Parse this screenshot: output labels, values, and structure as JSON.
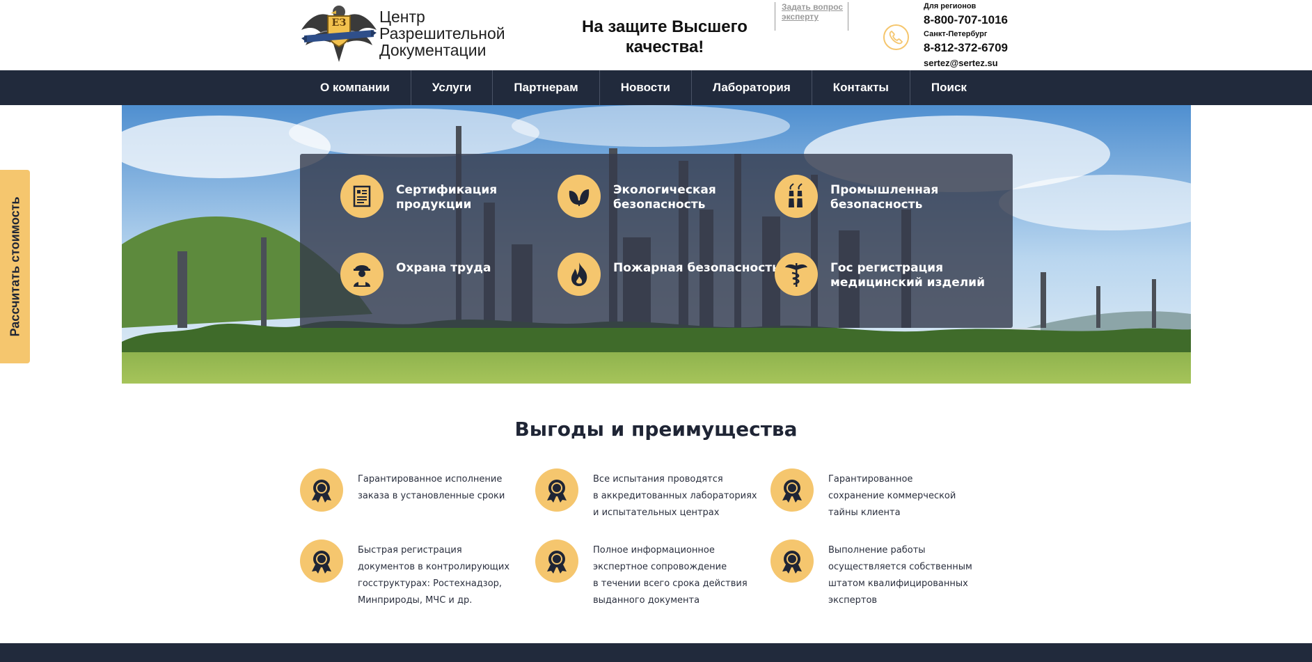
{
  "header": {
    "logo_text": [
      "Центр",
      "Разрешительной",
      "Документации"
    ],
    "logo_badge": "ЕЗ",
    "slogan": "На защите Высшего качества!",
    "ask_link": "Задать вопрос эксперту",
    "contacts": {
      "region_label": "Для регионов",
      "region_phone": "8-800-707-1016",
      "spb_label": "Санкт-Петербург",
      "spb_phone": "8-812-372-6709",
      "email": "sertez@sertez.su"
    }
  },
  "nav": {
    "items": [
      "О компании",
      "Услуги",
      "Партнерам",
      "Новости",
      "Лаборатория",
      "Контакты",
      "Поиск"
    ]
  },
  "calc_tab": "Рассчитать стоимость",
  "services": [
    {
      "label": "Сертификация\nпродукции",
      "icon": "certificate-icon"
    },
    {
      "label": "Экологическая\nбезопасность",
      "icon": "leaf-icon"
    },
    {
      "label": "Промышленная\nбезопасность",
      "icon": "factory-icon"
    },
    {
      "label": "Охрана труда",
      "icon": "worker-icon"
    },
    {
      "label": "Пожарная безопасность",
      "icon": "fire-icon"
    },
    {
      "label": "Гос регистрация\nмедицинский изделий",
      "icon": "caduceus-icon"
    }
  ],
  "benefits": {
    "title": "Выгоды и преимущества",
    "items": [
      "Гарантированное исполнение\nзаказа в установленные сроки",
      "Все испытания проводятся\nв аккредитованных лабораториях\nи испытательных центрах",
      "Гарантированное\nсохранение коммерческой\nтайны клиента",
      "Быстрая регистрация\nдокументов в контролирующих\nгосструктурах: Ростехнадзор,\nМинприроды, МЧС и др.",
      "Полное информационное\nэкспертное сопровождение\nв течении всего срока действия\nвыданного документа",
      "Выполнение работы\nосуществляется собственным\nштатом квалифицированных\nэкспертов"
    ]
  },
  "colors": {
    "accent": "#f5c66e",
    "dark": "#212a3c",
    "panel": "#343a4b"
  }
}
